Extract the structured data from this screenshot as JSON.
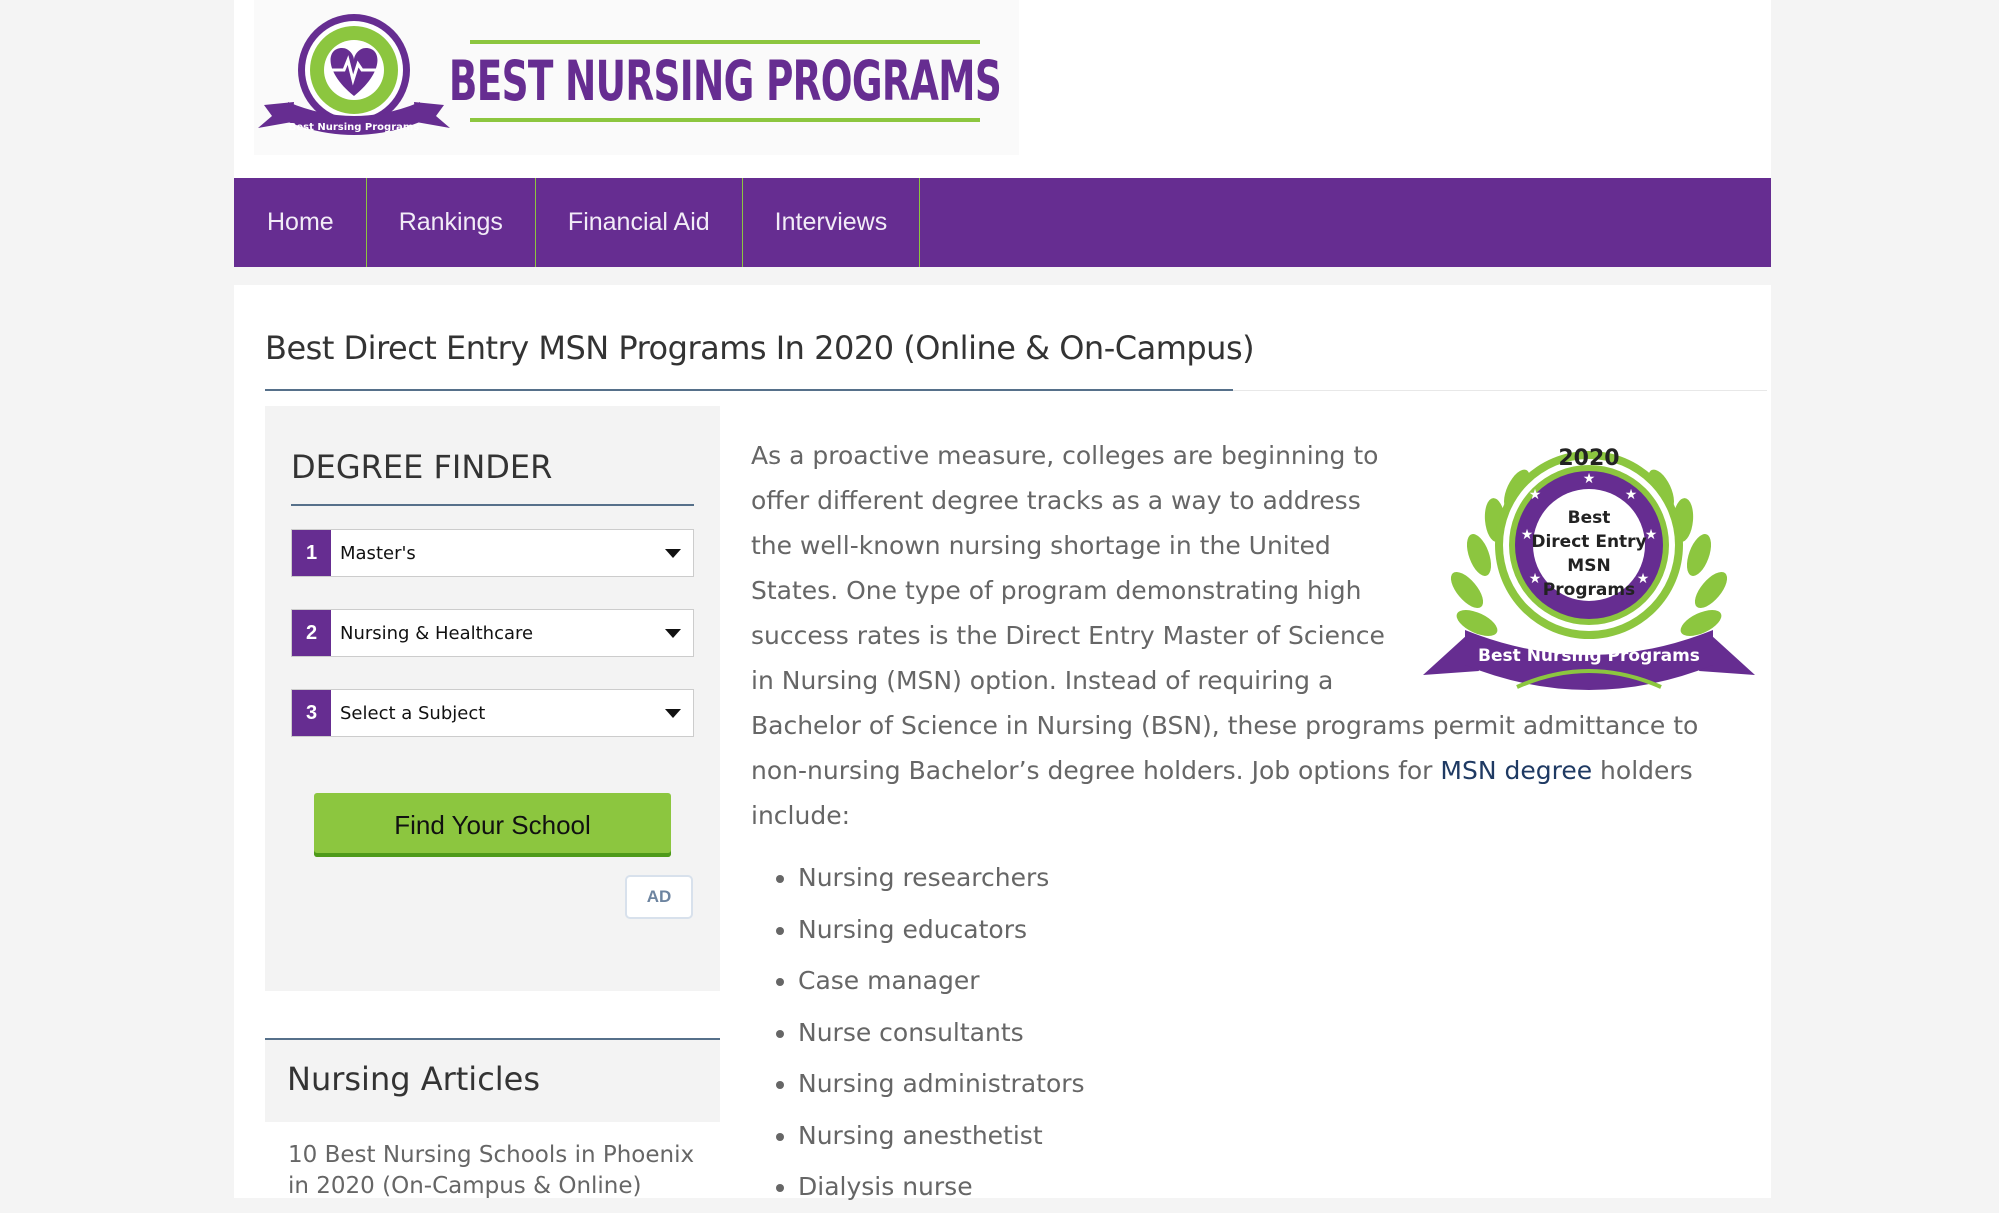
{
  "brand": {
    "badge_text": "Best Nursing Programs",
    "site_name": "BEST NURSING PROGRAMS",
    "purple": "#662d91",
    "green": "#8cc63f"
  },
  "nav": {
    "items": [
      {
        "label": "Home"
      },
      {
        "label": "Rankings"
      },
      {
        "label": "Financial Aid"
      },
      {
        "label": "Interviews"
      }
    ]
  },
  "page": {
    "title": "Best Direct Entry MSN Programs In 2020 (Online & On-Campus)"
  },
  "degree_finder": {
    "title": "DEGREE FINDER",
    "selects": [
      {
        "num": "1",
        "value": "Master's"
      },
      {
        "num": "2",
        "value": "Nursing & Healthcare"
      },
      {
        "num": "3",
        "value": "Select a Subject"
      }
    ],
    "button_label": "Find Your School",
    "ad_label": "AD"
  },
  "articles": {
    "title": "Nursing Articles",
    "items": [
      "10 Best Nursing Schools in Phoenix in 2020 (On-Campus & Online)"
    ]
  },
  "award": {
    "year": "2020",
    "line1": "Best",
    "line2": "Direct Entry",
    "line3": "MSN",
    "line4": "Programs",
    "ribbon": "Best Nursing Programs"
  },
  "content": {
    "intro_before_link": "As a proactive measure, colleges are beginning to offer different degree tracks as a way to address the well-known nursing shortage in the United States. One type of program demonstrating high success rates is the Direct Entry Master of Science in Nursing (MSN) option. Instead of requiring a Bachelor of Science in Nursing (BSN), these programs permit admittance to non-nursing Bachelor’s degree holders. Job options for ",
    "link_text": "MSN degree",
    "intro_after_link": " holders include:",
    "jobs": [
      "Nursing researchers",
      "Nursing educators",
      "Case manager",
      "Nurse consultants",
      "Nursing administrators",
      "Nursing anesthetist",
      "Dialysis nurse"
    ]
  }
}
